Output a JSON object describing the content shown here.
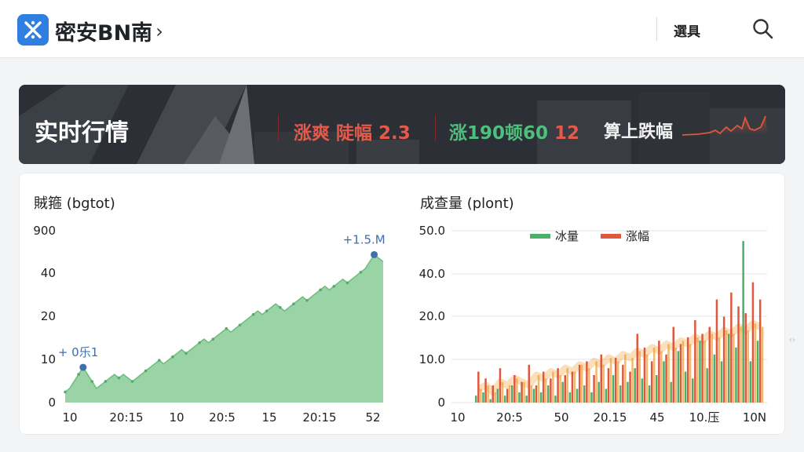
{
  "header": {
    "brand": "密安BN南",
    "menu_label": "選具"
  },
  "banner": {
    "title": "实时行情",
    "stat1": "涨爽 陡幅 2.3",
    "stat2_green": "涨190顿60",
    "stat2_red": "12",
    "label": "算上跌幅"
  },
  "charts": {
    "left_title": "賊箍 (bgtot)",
    "right_title": "成查量 (plont)"
  },
  "chart_data": [
    {
      "type": "area",
      "title": "賊箍 (bgtot)",
      "y_tick_labels": [
        "900",
        "40",
        "20",
        "10",
        "0"
      ],
      "x_tick_labels": [
        "10",
        "20:15",
        "10",
        "20:5",
        "15",
        "20:15",
        "52"
      ],
      "annotations": [
        {
          "text": "+ 0乐1",
          "index": 4
        },
        {
          "text": "+1.5.M",
          "index": 69
        }
      ],
      "series": [
        {
          "values": [
            3,
            4,
            6,
            8,
            10,
            8,
            6,
            4,
            5,
            6,
            7,
            8,
            7,
            8,
            7,
            6,
            7,
            8,
            9,
            10,
            11,
            12,
            11,
            12,
            13,
            14,
            15,
            14,
            15,
            16,
            17,
            18,
            17,
            18,
            19,
            20,
            21,
            20,
            21,
            22,
            23,
            24,
            25,
            26,
            25,
            26,
            27,
            28,
            27,
            26,
            27,
            28,
            29,
            30,
            29,
            30,
            31,
            32,
            33,
            32,
            33,
            34,
            35,
            34,
            35,
            36,
            37,
            38,
            40,
            42,
            41,
            40
          ]
        }
      ]
    },
    {
      "type": "bar",
      "title": "成查量 (plont)",
      "y_tick_labels": [
        "50.0",
        "40.0",
        "20.0",
        "10.0",
        "0"
      ],
      "x_tick_labels": [
        "10",
        "20:5",
        "50",
        "20.15",
        "45",
        "10.压",
        "10N"
      ],
      "legend_position": "top",
      "series": [
        {
          "name": "冰量",
          "color": "#4caf6a",
          "values": [
            2,
            3,
            1,
            4,
            2,
            5,
            3,
            2,
            4,
            3,
            5,
            2,
            6,
            3,
            4,
            5,
            3,
            6,
            4,
            8,
            5,
            6,
            10,
            7,
            5,
            8,
            12,
            6,
            15,
            9,
            7,
            18,
            10,
            14,
            12,
            20,
            16,
            47,
            12,
            18
          ]
        },
        {
          "name": "涨幅",
          "color": "#e0573c",
          "values": [
            9,
            7,
            5,
            10,
            4,
            8,
            6,
            11,
            5,
            9,
            7,
            10,
            8,
            9,
            11,
            12,
            8,
            14,
            10,
            13,
            11,
            9,
            20,
            16,
            12,
            18,
            14,
            22,
            17,
            19,
            24,
            20,
            22,
            30,
            25,
            32,
            28,
            26,
            35,
            30
          ]
        },
        {
          "name": "",
          "color": "#f0a23a",
          "values": [
            4,
            5,
            3,
            6,
            5,
            7,
            6,
            5,
            8,
            7,
            9,
            8,
            10,
            9,
            11,
            10,
            12,
            11,
            13,
            12,
            14,
            13,
            15,
            14,
            16,
            15,
            17,
            16,
            18,
            17,
            19,
            18,
            20,
            19,
            21,
            20,
            22,
            21,
            23,
            22
          ]
        }
      ]
    }
  ],
  "colors": {
    "brand_blue": "#2f7fe0",
    "up_red": "#e35a4a",
    "down_green": "#4fbf7d",
    "area_green": "#8fce9c",
    "marker_blue": "#3f6fae"
  }
}
